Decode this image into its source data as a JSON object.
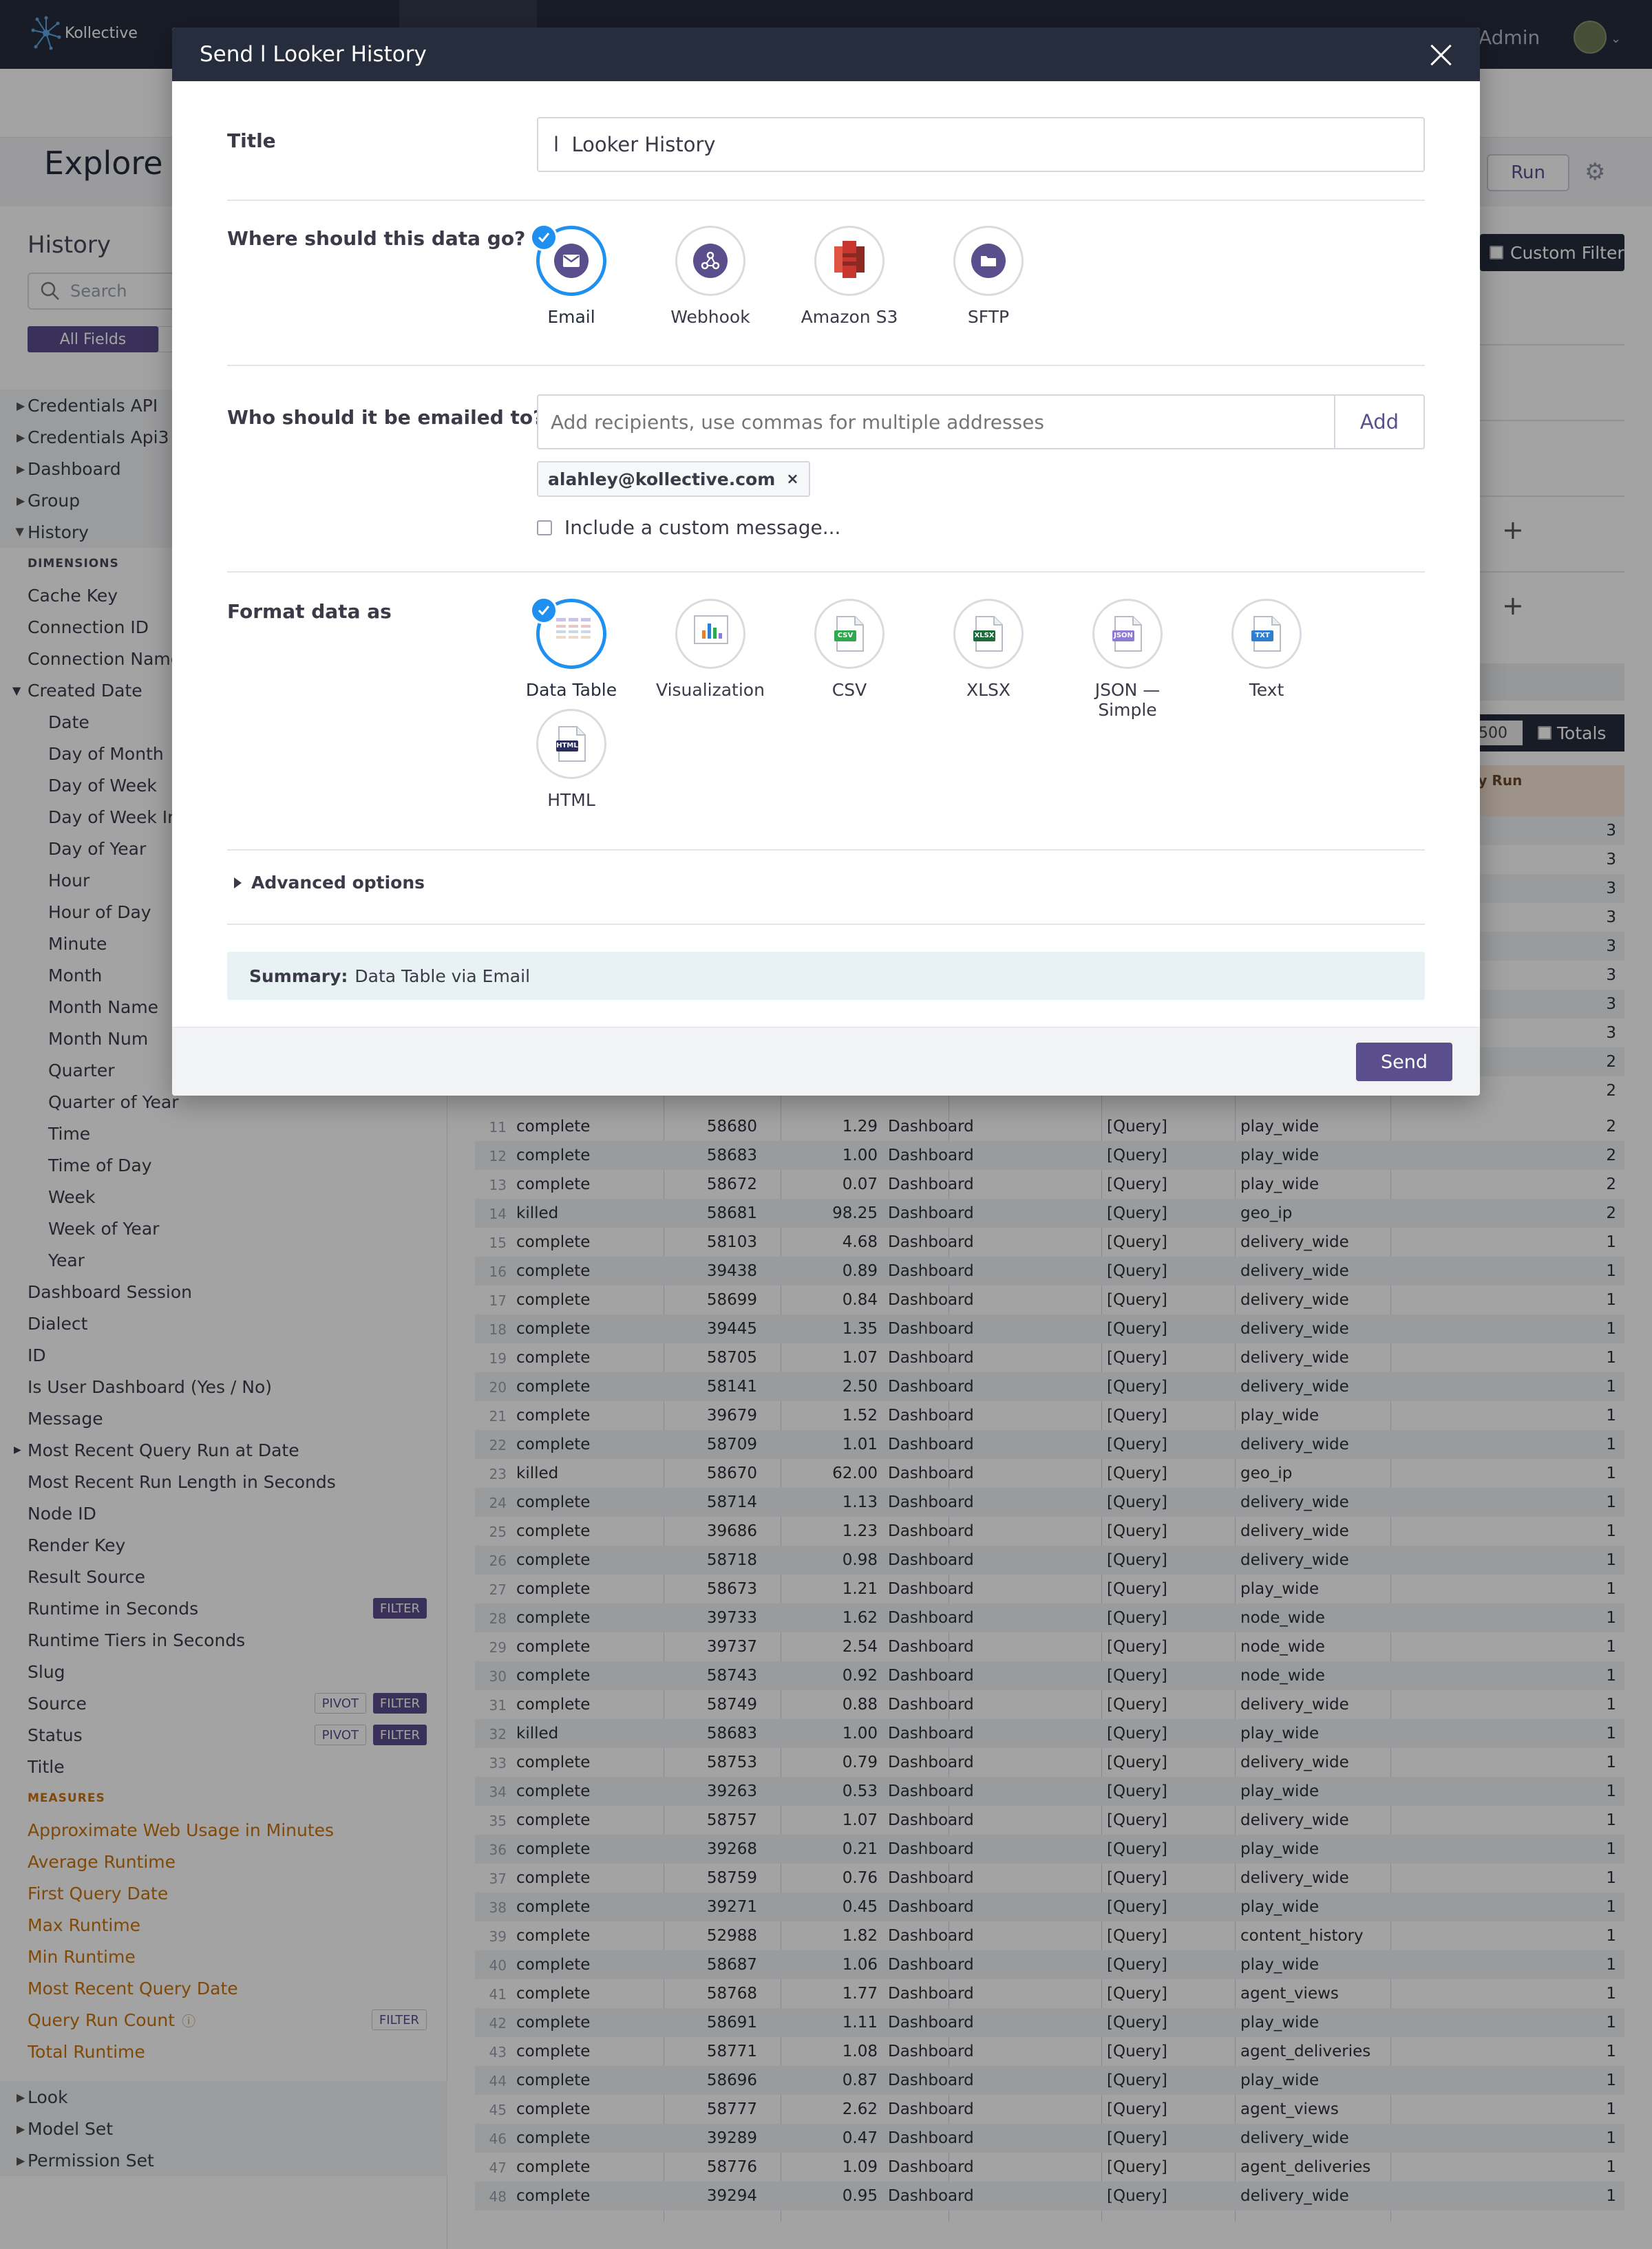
{
  "app": {
    "brand": "Kollective",
    "user_label": "Admin",
    "page_title": "Explore",
    "run_label": "Run",
    "custom_filter_label": "Custom Filter",
    "row_limit": "500",
    "totals_label": "Totals",
    "count_col_header": "ery Run"
  },
  "sidebar": {
    "title": "History",
    "search_placeholder": "Search",
    "all_fields_label": "All Fields",
    "groups_top": [
      "Credentials API",
      "Credentials Api3",
      "Dashboard",
      "Group",
      "History"
    ],
    "dimensions_label": "DIMENSIONS",
    "dimensions_a": [
      "Cache Key",
      "Connection ID",
      "Connection Name"
    ],
    "created_date_label": "Created Date",
    "created_date_items": [
      "Date",
      "Day of Month",
      "Day of Week",
      "Day of Week Ind",
      "Day of Year",
      "Hour",
      "Hour of Day",
      "Minute",
      "Month",
      "Month Name",
      "Month Num",
      "Quarter",
      "Quarter of Year",
      "Time",
      "Time of Day",
      "Week",
      "Week of Year",
      "Year"
    ],
    "dimensions_b": [
      "Dashboard Session",
      "Dialect",
      "ID",
      "Is User Dashboard (Yes / No)",
      "Message",
      "Most Recent Query Run at Date",
      "Most Recent Run Length in Seconds",
      "Node ID",
      "Render Key",
      "Result Source",
      "Runtime in Seconds",
      "Runtime Tiers in Seconds",
      "Slug",
      "Source",
      "Status",
      "Title"
    ],
    "measures_label": "MEASURES",
    "measures": [
      "Approximate Web Usage in Minutes",
      "Average Runtime",
      "First Query Date",
      "Max Runtime",
      "Min Runtime",
      "Most Recent Query Date",
      "Query Run Count",
      "Total Runtime"
    ],
    "groups_bottom": [
      "Look",
      "Model Set",
      "Permission Set"
    ],
    "filter_label": "FILTER",
    "pivot_label": "PIVOT"
  },
  "table": {
    "rows": [
      {
        "n": "11",
        "status": "complete",
        "id": "58680",
        "runtime": "1.29",
        "source": "Dashboard",
        "q": "[Query]",
        "slug": "play_wide",
        "count": "2"
      },
      {
        "n": "12",
        "status": "complete",
        "id": "58683",
        "runtime": "1.00",
        "source": "Dashboard",
        "q": "[Query]",
        "slug": "play_wide",
        "count": "2"
      },
      {
        "n": "13",
        "status": "complete",
        "id": "58672",
        "runtime": "0.07",
        "source": "Dashboard",
        "q": "[Query]",
        "slug": "play_wide",
        "count": "2"
      },
      {
        "n": "14",
        "status": "killed",
        "id": "58681",
        "runtime": "98.25",
        "source": "Dashboard",
        "q": "[Query]",
        "slug": "geo_ip",
        "count": "2"
      },
      {
        "n": "15",
        "status": "complete",
        "id": "58103",
        "runtime": "4.68",
        "source": "Dashboard",
        "q": "[Query]",
        "slug": "delivery_wide",
        "count": "1"
      },
      {
        "n": "16",
        "status": "complete",
        "id": "39438",
        "runtime": "0.89",
        "source": "Dashboard",
        "q": "[Query]",
        "slug": "delivery_wide",
        "count": "1"
      },
      {
        "n": "17",
        "status": "complete",
        "id": "58699",
        "runtime": "0.84",
        "source": "Dashboard",
        "q": "[Query]",
        "slug": "delivery_wide",
        "count": "1"
      },
      {
        "n": "18",
        "status": "complete",
        "id": "39445",
        "runtime": "1.35",
        "source": "Dashboard",
        "q": "[Query]",
        "slug": "delivery_wide",
        "count": "1"
      },
      {
        "n": "19",
        "status": "complete",
        "id": "58705",
        "runtime": "1.07",
        "source": "Dashboard",
        "q": "[Query]",
        "slug": "delivery_wide",
        "count": "1"
      },
      {
        "n": "20",
        "status": "complete",
        "id": "58141",
        "runtime": "2.50",
        "source": "Dashboard",
        "q": "[Query]",
        "slug": "delivery_wide",
        "count": "1"
      },
      {
        "n": "21",
        "status": "complete",
        "id": "39679",
        "runtime": "1.52",
        "source": "Dashboard",
        "q": "[Query]",
        "slug": "play_wide",
        "count": "1"
      },
      {
        "n": "22",
        "status": "complete",
        "id": "58709",
        "runtime": "1.01",
        "source": "Dashboard",
        "q": "[Query]",
        "slug": "delivery_wide",
        "count": "1"
      },
      {
        "n": "23",
        "status": "killed",
        "id": "58670",
        "runtime": "62.00",
        "source": "Dashboard",
        "q": "[Query]",
        "slug": "geo_ip",
        "count": "1"
      },
      {
        "n": "24",
        "status": "complete",
        "id": "58714",
        "runtime": "1.13",
        "source": "Dashboard",
        "q": "[Query]",
        "slug": "delivery_wide",
        "count": "1"
      },
      {
        "n": "25",
        "status": "complete",
        "id": "39686",
        "runtime": "1.23",
        "source": "Dashboard",
        "q": "[Query]",
        "slug": "delivery_wide",
        "count": "1"
      },
      {
        "n": "26",
        "status": "complete",
        "id": "58718",
        "runtime": "0.98",
        "source": "Dashboard",
        "q": "[Query]",
        "slug": "delivery_wide",
        "count": "1"
      },
      {
        "n": "27",
        "status": "complete",
        "id": "58673",
        "runtime": "1.21",
        "source": "Dashboard",
        "q": "[Query]",
        "slug": "play_wide",
        "count": "1"
      },
      {
        "n": "28",
        "status": "complete",
        "id": "39733",
        "runtime": "1.62",
        "source": "Dashboard",
        "q": "[Query]",
        "slug": "node_wide",
        "count": "1"
      },
      {
        "n": "29",
        "status": "complete",
        "id": "39737",
        "runtime": "2.54",
        "source": "Dashboard",
        "q": "[Query]",
        "slug": "node_wide",
        "count": "1"
      },
      {
        "n": "30",
        "status": "complete",
        "id": "58743",
        "runtime": "0.92",
        "source": "Dashboard",
        "q": "[Query]",
        "slug": "node_wide",
        "count": "1"
      },
      {
        "n": "31",
        "status": "complete",
        "id": "58749",
        "runtime": "0.88",
        "source": "Dashboard",
        "q": "[Query]",
        "slug": "delivery_wide",
        "count": "1"
      },
      {
        "n": "32",
        "status": "killed",
        "id": "58683",
        "runtime": "1.00",
        "source": "Dashboard",
        "q": "[Query]",
        "slug": "play_wide",
        "count": "1"
      },
      {
        "n": "33",
        "status": "complete",
        "id": "58753",
        "runtime": "0.79",
        "source": "Dashboard",
        "q": "[Query]",
        "slug": "delivery_wide",
        "count": "1"
      },
      {
        "n": "34",
        "status": "complete",
        "id": "39263",
        "runtime": "0.53",
        "source": "Dashboard",
        "q": "[Query]",
        "slug": "play_wide",
        "count": "1"
      },
      {
        "n": "35",
        "status": "complete",
        "id": "58757",
        "runtime": "1.07",
        "source": "Dashboard",
        "q": "[Query]",
        "slug": "delivery_wide",
        "count": "1"
      },
      {
        "n": "36",
        "status": "complete",
        "id": "39268",
        "runtime": "0.21",
        "source": "Dashboard",
        "q": "[Query]",
        "slug": "play_wide",
        "count": "1"
      },
      {
        "n": "37",
        "status": "complete",
        "id": "58759",
        "runtime": "0.76",
        "source": "Dashboard",
        "q": "[Query]",
        "slug": "delivery_wide",
        "count": "1"
      },
      {
        "n": "38",
        "status": "complete",
        "id": "39271",
        "runtime": "0.45",
        "source": "Dashboard",
        "q": "[Query]",
        "slug": "play_wide",
        "count": "1"
      },
      {
        "n": "39",
        "status": "complete",
        "id": "52988",
        "runtime": "1.82",
        "source": "Dashboard",
        "q": "[Query]",
        "slug": "content_history",
        "count": "1"
      },
      {
        "n": "40",
        "status": "complete",
        "id": "58687",
        "runtime": "1.06",
        "source": "Dashboard",
        "q": "[Query]",
        "slug": "play_wide",
        "count": "1"
      },
      {
        "n": "41",
        "status": "complete",
        "id": "58768",
        "runtime": "1.77",
        "source": "Dashboard",
        "q": "[Query]",
        "slug": "agent_views",
        "count": "1"
      },
      {
        "n": "42",
        "status": "complete",
        "id": "58691",
        "runtime": "1.11",
        "source": "Dashboard",
        "q": "[Query]",
        "slug": "play_wide",
        "count": "1"
      },
      {
        "n": "43",
        "status": "complete",
        "id": "58771",
        "runtime": "1.08",
        "source": "Dashboard",
        "q": "[Query]",
        "slug": "agent_deliveries",
        "count": "1"
      },
      {
        "n": "44",
        "status": "complete",
        "id": "58696",
        "runtime": "0.87",
        "source": "Dashboard",
        "q": "[Query]",
        "slug": "play_wide",
        "count": "1"
      },
      {
        "n": "45",
        "status": "complete",
        "id": "58777",
        "runtime": "2.62",
        "source": "Dashboard",
        "q": "[Query]",
        "slug": "agent_views",
        "count": "1"
      },
      {
        "n": "46",
        "status": "complete",
        "id": "39289",
        "runtime": "0.47",
        "source": "Dashboard",
        "q": "[Query]",
        "slug": "delivery_wide",
        "count": "1"
      },
      {
        "n": "47",
        "status": "complete",
        "id": "58776",
        "runtime": "1.09",
        "source": "Dashboard",
        "q": "[Query]",
        "slug": "agent_deliveries",
        "count": "1"
      },
      {
        "n": "48",
        "status": "complete",
        "id": "39294",
        "runtime": "0.95",
        "source": "Dashboard",
        "q": "[Query]",
        "slug": "delivery_wide",
        "count": "1"
      }
    ],
    "visible_count_column_top": [
      "3",
      "3",
      "3",
      "3",
      "3",
      "3",
      "3",
      "3",
      "2",
      "2"
    ]
  },
  "modal": {
    "header": "Send l Looker History",
    "title_label": "Title",
    "title_value": "l  Looker History",
    "destination_label": "Where should this data go?",
    "destinations": [
      {
        "label": "Email",
        "icon": "envelope-icon",
        "selected": true
      },
      {
        "label": "Webhook",
        "icon": "webhook-icon",
        "selected": false
      },
      {
        "label": "Amazon S3",
        "icon": "amazon-s3-icon",
        "selected": false
      },
      {
        "label": "SFTP",
        "icon": "folder-icon",
        "selected": false
      }
    ],
    "recipients_label": "Who should it be emailed to?",
    "recipients_placeholder": "Add recipients, use commas for multiple addresses",
    "add_label": "Add",
    "recipient_chip": "alahley@kollective.com",
    "chip_remove": "×",
    "custom_message_label": "Include a custom message...",
    "format_label": "Format data as",
    "formats": [
      {
        "label": "Data Table",
        "icon": "data-table-icon",
        "selected": true
      },
      {
        "label": "Visualization",
        "icon": "visualization-icon",
        "selected": false
      },
      {
        "label": "CSV",
        "icon": "csv-file-icon",
        "badge": "CSV",
        "badge_color": "#2fa84f",
        "selected": false
      },
      {
        "label": "XLSX",
        "icon": "xlsx-file-icon",
        "badge": "XLSX",
        "badge_color": "#1d6b3a",
        "selected": false
      },
      {
        "label": "JSON — Simple",
        "icon": "json-file-icon",
        "badge": "JSON",
        "badge_color": "#8e7bd6",
        "selected": false
      },
      {
        "label": "Text",
        "icon": "txt-file-icon",
        "badge": "TXT",
        "badge_color": "#2f7fd1",
        "selected": false
      },
      {
        "label": "HTML",
        "icon": "html-file-icon",
        "badge": "HTML",
        "badge_color": "#2b2d5c",
        "selected": false
      }
    ],
    "advanced_label": "Advanced options",
    "summary_label": "Summary:",
    "summary_value": "Data Table via Email",
    "send_label": "Send"
  },
  "colors": {
    "accent_purple": "#5a4e8c",
    "selection_blue": "#1f8ff0",
    "nav_dark": "#262d3d",
    "measure_orange": "#c8720d"
  }
}
